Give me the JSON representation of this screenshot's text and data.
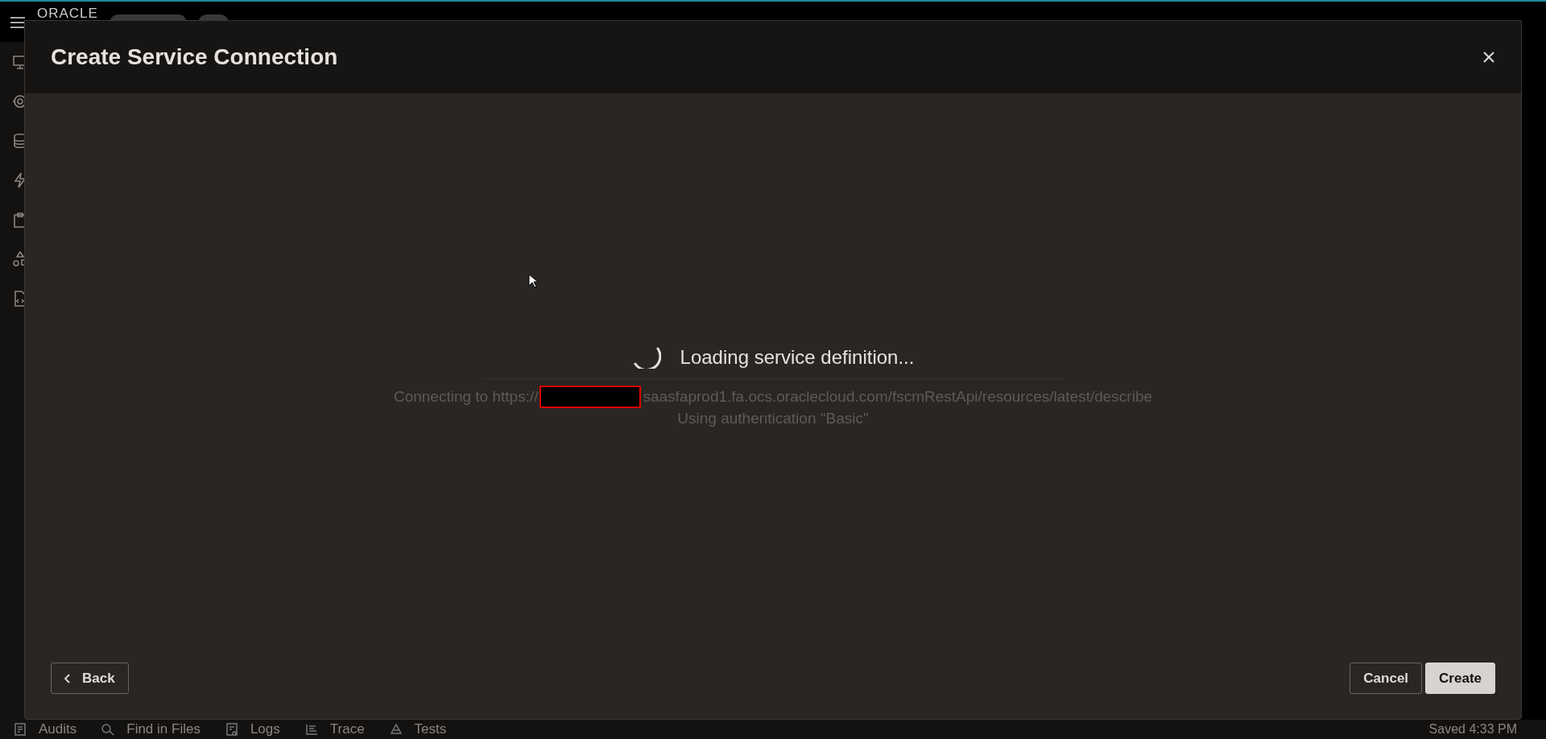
{
  "app_bar": {
    "logo": "ORACLE"
  },
  "dialog": {
    "title": "Create Service Connection",
    "loading": {
      "message": "Loading service definition...",
      "url_prefix": "Connecting to https://",
      "url_rest": "saasfaprod1.fa.ocs.oraclecloud.com/fscmRestApi/resources/latest/describe",
      "auth": "Using authentication \"Basic\""
    },
    "back_button": "Back",
    "cancel_button": "Cancel",
    "create_button": "Create"
  },
  "bottom_bar": {
    "tabs": [
      "Audits",
      "Find in Files",
      "Logs",
      "Trace",
      "Tests"
    ],
    "status": "Saved 4:33 PM"
  }
}
